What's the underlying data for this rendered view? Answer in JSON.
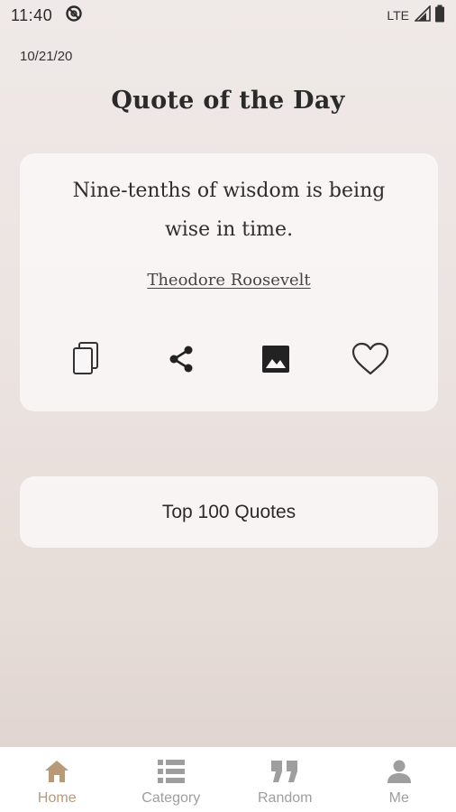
{
  "status_bar": {
    "time": "11:40",
    "network": "LTE"
  },
  "date": "10/21/20",
  "title": "Quote of the Day",
  "quote": {
    "text": "Nine-tenths of wisdom is being wise in time.",
    "author": "Theodore Roosevelt",
    "actions": [
      {
        "icon": "copy-icon"
      },
      {
        "icon": "share-icon"
      },
      {
        "icon": "image-icon"
      },
      {
        "icon": "heart-icon"
      }
    ]
  },
  "top_quotes_label": "Top 100 Quotes",
  "nav": {
    "items": [
      {
        "label": "Home",
        "icon": "home-icon",
        "active": true
      },
      {
        "label": "Category",
        "icon": "list-icon",
        "active": false
      },
      {
        "label": "Random",
        "icon": "quote-icon",
        "active": false
      },
      {
        "label": "Me",
        "icon": "person-icon",
        "active": false
      }
    ]
  },
  "colors": {
    "active": "#b89a78",
    "inactive": "#9e9e9e"
  }
}
